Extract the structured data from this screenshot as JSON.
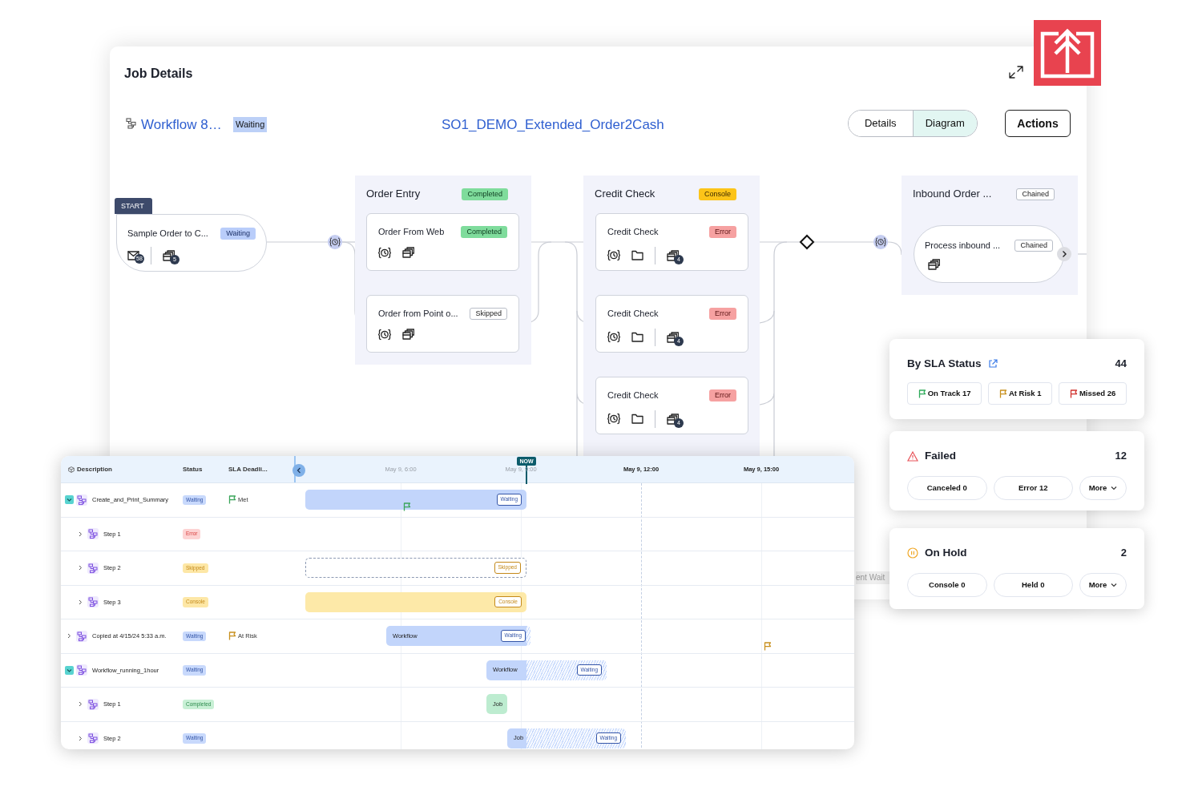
{
  "window": {
    "title": "Job Details"
  },
  "header": {
    "workflow_link": "Workflow 8…",
    "status": "Waiting",
    "job_name": "SO1_DEMO_Extended_Order2Cash",
    "view_tabs": [
      {
        "label": "Details",
        "selected": false
      },
      {
        "label": "Diagram",
        "selected": true
      }
    ],
    "actions_button": "Actions"
  },
  "diagram": {
    "start": {
      "tag": "START",
      "title": "Sample Order to C...",
      "status": {
        "text": "Waiting",
        "kind": "waiting"
      },
      "counts": [
        "58",
        "5"
      ]
    },
    "groups": [
      {
        "title": "Order Entry",
        "status": {
          "text": "Completed",
          "kind": "completed"
        },
        "nodes": [
          {
            "title": "Order From Web",
            "status": {
              "text": "Completed",
              "kind": "completed"
            },
            "kind": "job"
          },
          {
            "title": "Order from Point o...",
            "status": {
              "text": "Skipped",
              "kind": "skipped"
            },
            "kind": "job"
          }
        ]
      },
      {
        "title": "Credit Check",
        "status": {
          "text": "Console",
          "kind": "console"
        },
        "nodes": [
          {
            "title": "Credit Check",
            "status": {
              "text": "Error",
              "kind": "error"
            },
            "kind": "job_folder",
            "count": "4"
          },
          {
            "title": "Credit Check",
            "status": {
              "text": "Error",
              "kind": "error"
            },
            "kind": "job_folder",
            "count": "4"
          },
          {
            "title": "Credit Check",
            "status": {
              "text": "Error",
              "kind": "error"
            },
            "kind": "job_folder",
            "count": "4"
          }
        ]
      },
      {
        "title": "Inbound Order ...",
        "status": {
          "text": "Chained",
          "kind": "chained"
        },
        "nodes": [
          {
            "title": "Process inbound ...",
            "status": {
              "text": "Chained",
              "kind": "chained"
            },
            "kind": "chained"
          }
        ]
      }
    ],
    "partial_label": "ent Wait"
  },
  "gantt": {
    "columns": [
      "Description",
      "Status",
      "SLA Deadli..."
    ],
    "ticks": [
      {
        "label": "May 9, 6:00",
        "past": true
      },
      {
        "label": "May 9, 9:00",
        "past": true
      },
      {
        "label": "May 9, 12:00",
        "past": false
      },
      {
        "label": "May 9, 15:00",
        "past": false
      }
    ],
    "now_label": "NOW",
    "rows": [
      {
        "name": "Create_and_Print_Summary",
        "status": {
          "text": "Waiting",
          "kind": "waiting"
        },
        "expanded": true,
        "sla": {
          "label": "Met",
          "color": "#3aa55a"
        },
        "bar": {
          "status": "Waiting"
        },
        "children": [
          {
            "name": "Step 1",
            "status": {
              "text": "Error",
              "kind": "error"
            },
            "expanded": false
          },
          {
            "name": "Step 2",
            "status": {
              "text": "Skipped",
              "kind": "skipped"
            },
            "expanded": false,
            "bar": {
              "status": "Skipped"
            }
          },
          {
            "name": "Step 3",
            "status": {
              "text": "Console",
              "kind": "console"
            },
            "expanded": false,
            "bar": {
              "status": "Console"
            }
          }
        ]
      },
      {
        "name": "Copied at 4/15/24 5:33 a.m.",
        "status": {
          "text": "Waiting",
          "kind": "waiting"
        },
        "expanded": false,
        "sla": {
          "label": "At Risk",
          "color": "#c8901e"
        },
        "bar": {
          "label": "Workflow",
          "status": "Waiting"
        }
      },
      {
        "name": "Workflow_running_1hour",
        "status": {
          "text": "Waiting",
          "kind": "waiting"
        },
        "expanded": true,
        "bar": {
          "label": "Workflow",
          "status": "Waiting"
        },
        "children": [
          {
            "name": "Step 1",
            "status": {
              "text": "Completed",
              "kind": "completed"
            },
            "expanded": false,
            "bar": {
              "label": "Job"
            }
          },
          {
            "name": "Step 2",
            "status": {
              "text": "Waiting",
              "kind": "waiting"
            },
            "expanded": false,
            "bar": {
              "label": "Job",
              "status": "Waiting"
            }
          }
        ]
      }
    ]
  },
  "cards": [
    {
      "kind": "sla",
      "title": "By SLA Status",
      "total": "44",
      "buttons": [
        {
          "label": "On Track 17",
          "color": "#2eaa5a"
        },
        {
          "label": "At Risk 1",
          "color": "#c8901e"
        },
        {
          "label": "Missed 26",
          "color": "#d0312d"
        }
      ]
    },
    {
      "kind": "failed",
      "title": "Failed",
      "total": "12",
      "buttons": [
        {
          "label": "Canceled 0"
        },
        {
          "label": "Error 12"
        }
      ],
      "more": "More"
    },
    {
      "kind": "hold",
      "title": "On Hold",
      "total": "2",
      "buttons": [
        {
          "label": "Console 0"
        },
        {
          "label": "Held 0"
        }
      ],
      "more": "More"
    }
  ]
}
